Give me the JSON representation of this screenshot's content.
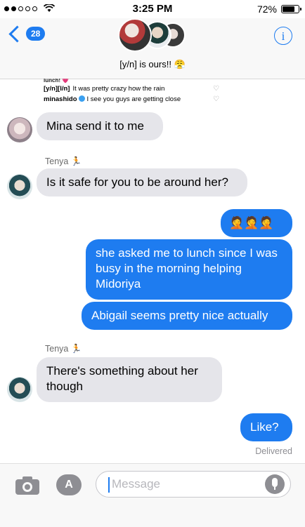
{
  "status_bar": {
    "time": "3:25 PM",
    "battery_percent_label": "72%",
    "battery_level": 0.72,
    "signal_bars_filled": 2,
    "signal_bars_total": 5
  },
  "header": {
    "back_count": "28",
    "title": "[y/n] is ours!! 😤"
  },
  "snippet": {
    "cut_text": "lunch! 💗",
    "rows": [
      {
        "user": "[y/n][l/n]",
        "text": "It was pretty crazy how the rain",
        "verified": false
      },
      {
        "user": "minashido",
        "text": "I see you guys are getting close",
        "verified": true
      }
    ]
  },
  "messages": [
    {
      "direction": "in",
      "avatar": "mina",
      "text": "Mina send it to me"
    },
    {
      "sender": "Tenya 🏃"
    },
    {
      "direction": "in",
      "avatar": "tenya",
      "text": "Is it safe for you to be around her?"
    },
    {
      "direction": "out",
      "text": "🤦🤦🤦"
    },
    {
      "direction": "out",
      "text": "she asked me to lunch since I was busy in the morning helping Midoriya"
    },
    {
      "direction": "out",
      "text": "Abigail seems pretty nice actually"
    },
    {
      "sender": "Tenya 🏃"
    },
    {
      "direction": "in",
      "avatar": "tenya",
      "text": "There's something about her though"
    },
    {
      "direction": "out",
      "text": "Like?"
    }
  ],
  "delivered_label": "Delivered",
  "input": {
    "placeholder": "Message"
  },
  "colors": {
    "accent": "#1e7cf0",
    "incoming_bubble": "#e5e5ea",
    "outgoing_bubble": "#1e7cf0"
  }
}
